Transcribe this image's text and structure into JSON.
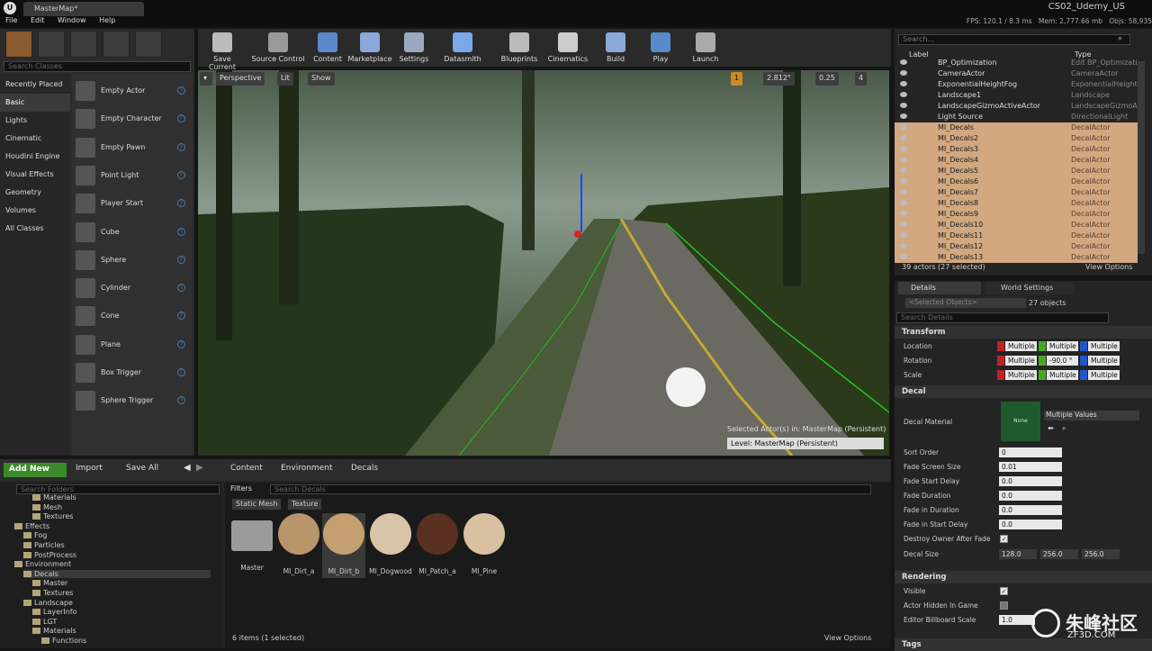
{
  "app": {
    "logo": "U",
    "tab_title": "MasterMap*",
    "project": "CS02_Udemy_US"
  },
  "menu": [
    "File",
    "Edit",
    "Window",
    "Help"
  ],
  "stats": {
    "fps": "FPS: 120.1 / 8.3 ms",
    "mem": "Mem: 2,777.66 mb",
    "objs": "Objs: 58,935"
  },
  "modes": {
    "search_placeholder": "Search Classes",
    "categories": [
      "Recently Placed",
      "Basic",
      "Lights",
      "Cinematic",
      "Houdini Engine",
      "Visual Effects",
      "Geometry",
      "Volumes",
      "All Classes"
    ],
    "selected_category": "Basic",
    "actors": [
      "Empty Actor",
      "Empty Character",
      "Empty Pawn",
      "Point Light",
      "Player Start",
      "Cube",
      "Sphere",
      "Cylinder",
      "Cone",
      "Plane",
      "Box Trigger",
      "Sphere Trigger"
    ],
    "help_icon": "?"
  },
  "toolbar": [
    {
      "label": "Save Current",
      "icon": "save-icon"
    },
    {
      "label": "Source Control",
      "icon": "source-control-icon"
    },
    {
      "label": "Content",
      "icon": "content-icon"
    },
    {
      "label": "Marketplace",
      "icon": "marketplace-icon"
    },
    {
      "label": "Settings",
      "icon": "settings-icon"
    },
    {
      "label": "Datasmith",
      "icon": "datasmith-icon"
    },
    {
      "label": "Blueprints",
      "icon": "blueprints-icon"
    },
    {
      "label": "Cinematics",
      "icon": "cinematics-icon"
    },
    {
      "label": "Build",
      "icon": "build-icon"
    },
    {
      "label": "Play",
      "icon": "play-icon"
    },
    {
      "label": "Launch",
      "icon": "launch-icon"
    }
  ],
  "viewport": {
    "perspective": "Perspective",
    "lit": "Lit",
    "show": "Show",
    "grid": "1",
    "rot": "2.812°",
    "scale": "0.25",
    "cam": "4",
    "selected_actors": "Selected Actor(s) in:  MasterMap (Persistent)",
    "level": "Level:  MasterMap (Persistent)"
  },
  "outliner": {
    "search_placeholder": "Search...",
    "col_label": "Label",
    "col_type": "Type",
    "rows": [
      {
        "name": "BP_Optimization",
        "type": "Edit BP_Optimizati",
        "sel": false
      },
      {
        "name": "CameraActor",
        "type": "CameraActor",
        "sel": false
      },
      {
        "name": "ExponentialHeightFog",
        "type": "ExponentialHeightF",
        "sel": false
      },
      {
        "name": "Landscape1",
        "type": "Landscape",
        "sel": false
      },
      {
        "name": "LandscapeGizmoActiveActor",
        "type": "LandscapeGizmoAc",
        "sel": false
      },
      {
        "name": "Light Source",
        "type": "DirectionalLight",
        "sel": false
      },
      {
        "name": "MI_Decals",
        "type": "DecalActor",
        "sel": true
      },
      {
        "name": "MI_Decals2",
        "type": "DecalActor",
        "sel": true
      },
      {
        "name": "MI_Decals3",
        "type": "DecalActor",
        "sel": true
      },
      {
        "name": "MI_Decals4",
        "type": "DecalActor",
        "sel": true
      },
      {
        "name": "MI_Decals5",
        "type": "DecalActor",
        "sel": true
      },
      {
        "name": "MI_Decals6",
        "type": "DecalActor",
        "sel": true
      },
      {
        "name": "MI_Decals7",
        "type": "DecalActor",
        "sel": true
      },
      {
        "name": "MI_Decals8",
        "type": "DecalActor",
        "sel": true
      },
      {
        "name": "MI_Decals9",
        "type": "DecalActor",
        "sel": true
      },
      {
        "name": "MI_Decals10",
        "type": "DecalActor",
        "sel": true
      },
      {
        "name": "MI_Decals11",
        "type": "DecalActor",
        "sel": true
      },
      {
        "name": "MI_Decals12",
        "type": "DecalActor",
        "sel": true
      },
      {
        "name": "MI_Decals13",
        "type": "DecalActor",
        "sel": true
      }
    ],
    "count": "39 actors (27 selected)",
    "view_options": "View Options"
  },
  "details": {
    "tab_details": "Details",
    "tab_world": "World Settings",
    "selected": "<Selected Objects>",
    "objects": "27 objects",
    "search_placeholder": "Search Details",
    "transform": "Transform",
    "location": "Location",
    "rotation": "Rotation",
    "scale": "Scale",
    "multiple": "Multiple",
    "rot_y": "-90.0 °",
    "decal": "Decal",
    "decal_material": "Decal Material",
    "none": "None",
    "multiple_values": "Multiple Values",
    "sort_order": "Sort Order",
    "sort_order_val": "0",
    "fade_screen_size": "Fade Screen Size",
    "fade_screen_size_val": "0.01",
    "fade_start_delay": "Fade Start Delay",
    "fade_start_delay_val": "0.0",
    "fade_duration": "Fade Duration",
    "fade_duration_val": "0.0",
    "fade_in_duration": "Fade in Duration",
    "fade_in_duration_val": "0.0",
    "fade_in_start_delay": "Fade in Start Delay",
    "fade_in_start_delay_val": "0.0",
    "destroy_owner": "Destroy Owner After Fade",
    "decal_size": "Decal Size",
    "size_x": "128.0",
    "size_y": "256.0",
    "size_z": "256.0",
    "rendering": "Rendering",
    "visible": "Visible",
    "actor_hidden": "Actor Hidden In Game",
    "billboard_scale": "Editor Billboard Scale",
    "billboard_val": "1.0",
    "tags": "Tags"
  },
  "content_browser": {
    "add_new": "Add New",
    "import": "Import",
    "save_all": "Save All",
    "path": [
      "Content",
      "Environment",
      "Decals"
    ],
    "search_folders": "Search Folders",
    "folders": [
      {
        "name": "Materials",
        "indent": 3
      },
      {
        "name": "Mesh",
        "indent": 3
      },
      {
        "name": "Textures",
        "indent": 3
      },
      {
        "name": "Effects",
        "indent": 1
      },
      {
        "name": "Fog",
        "indent": 2
      },
      {
        "name": "Particles",
        "indent": 2
      },
      {
        "name": "PostProcess",
        "indent": 2
      },
      {
        "name": "Environment",
        "indent": 1
      },
      {
        "name": "Decals",
        "indent": 2
      },
      {
        "name": "Master",
        "indent": 3
      },
      {
        "name": "Textures",
        "indent": 3
      },
      {
        "name": "Landscape",
        "indent": 2
      },
      {
        "name": "LayerInfo",
        "indent": 3
      },
      {
        "name": "LGT",
        "indent": 3
      },
      {
        "name": "Materials",
        "indent": 3
      },
      {
        "name": "Functions",
        "indent": 4
      }
    ],
    "filters": "Filters",
    "search_decals": "Search Decals",
    "filter_chips": [
      "Static Mesh",
      "Texture"
    ],
    "assets": [
      "Master",
      "MI_Dirt_a",
      "MI_Dirt_b",
      "MI_Dogwood",
      "MI_Patch_a",
      "MI_Pine"
    ],
    "count": "6 items (1 selected)",
    "view_options": "View Options"
  },
  "watermark": {
    "brand": "朱峰社区",
    "site": "ZF3D.COM"
  }
}
